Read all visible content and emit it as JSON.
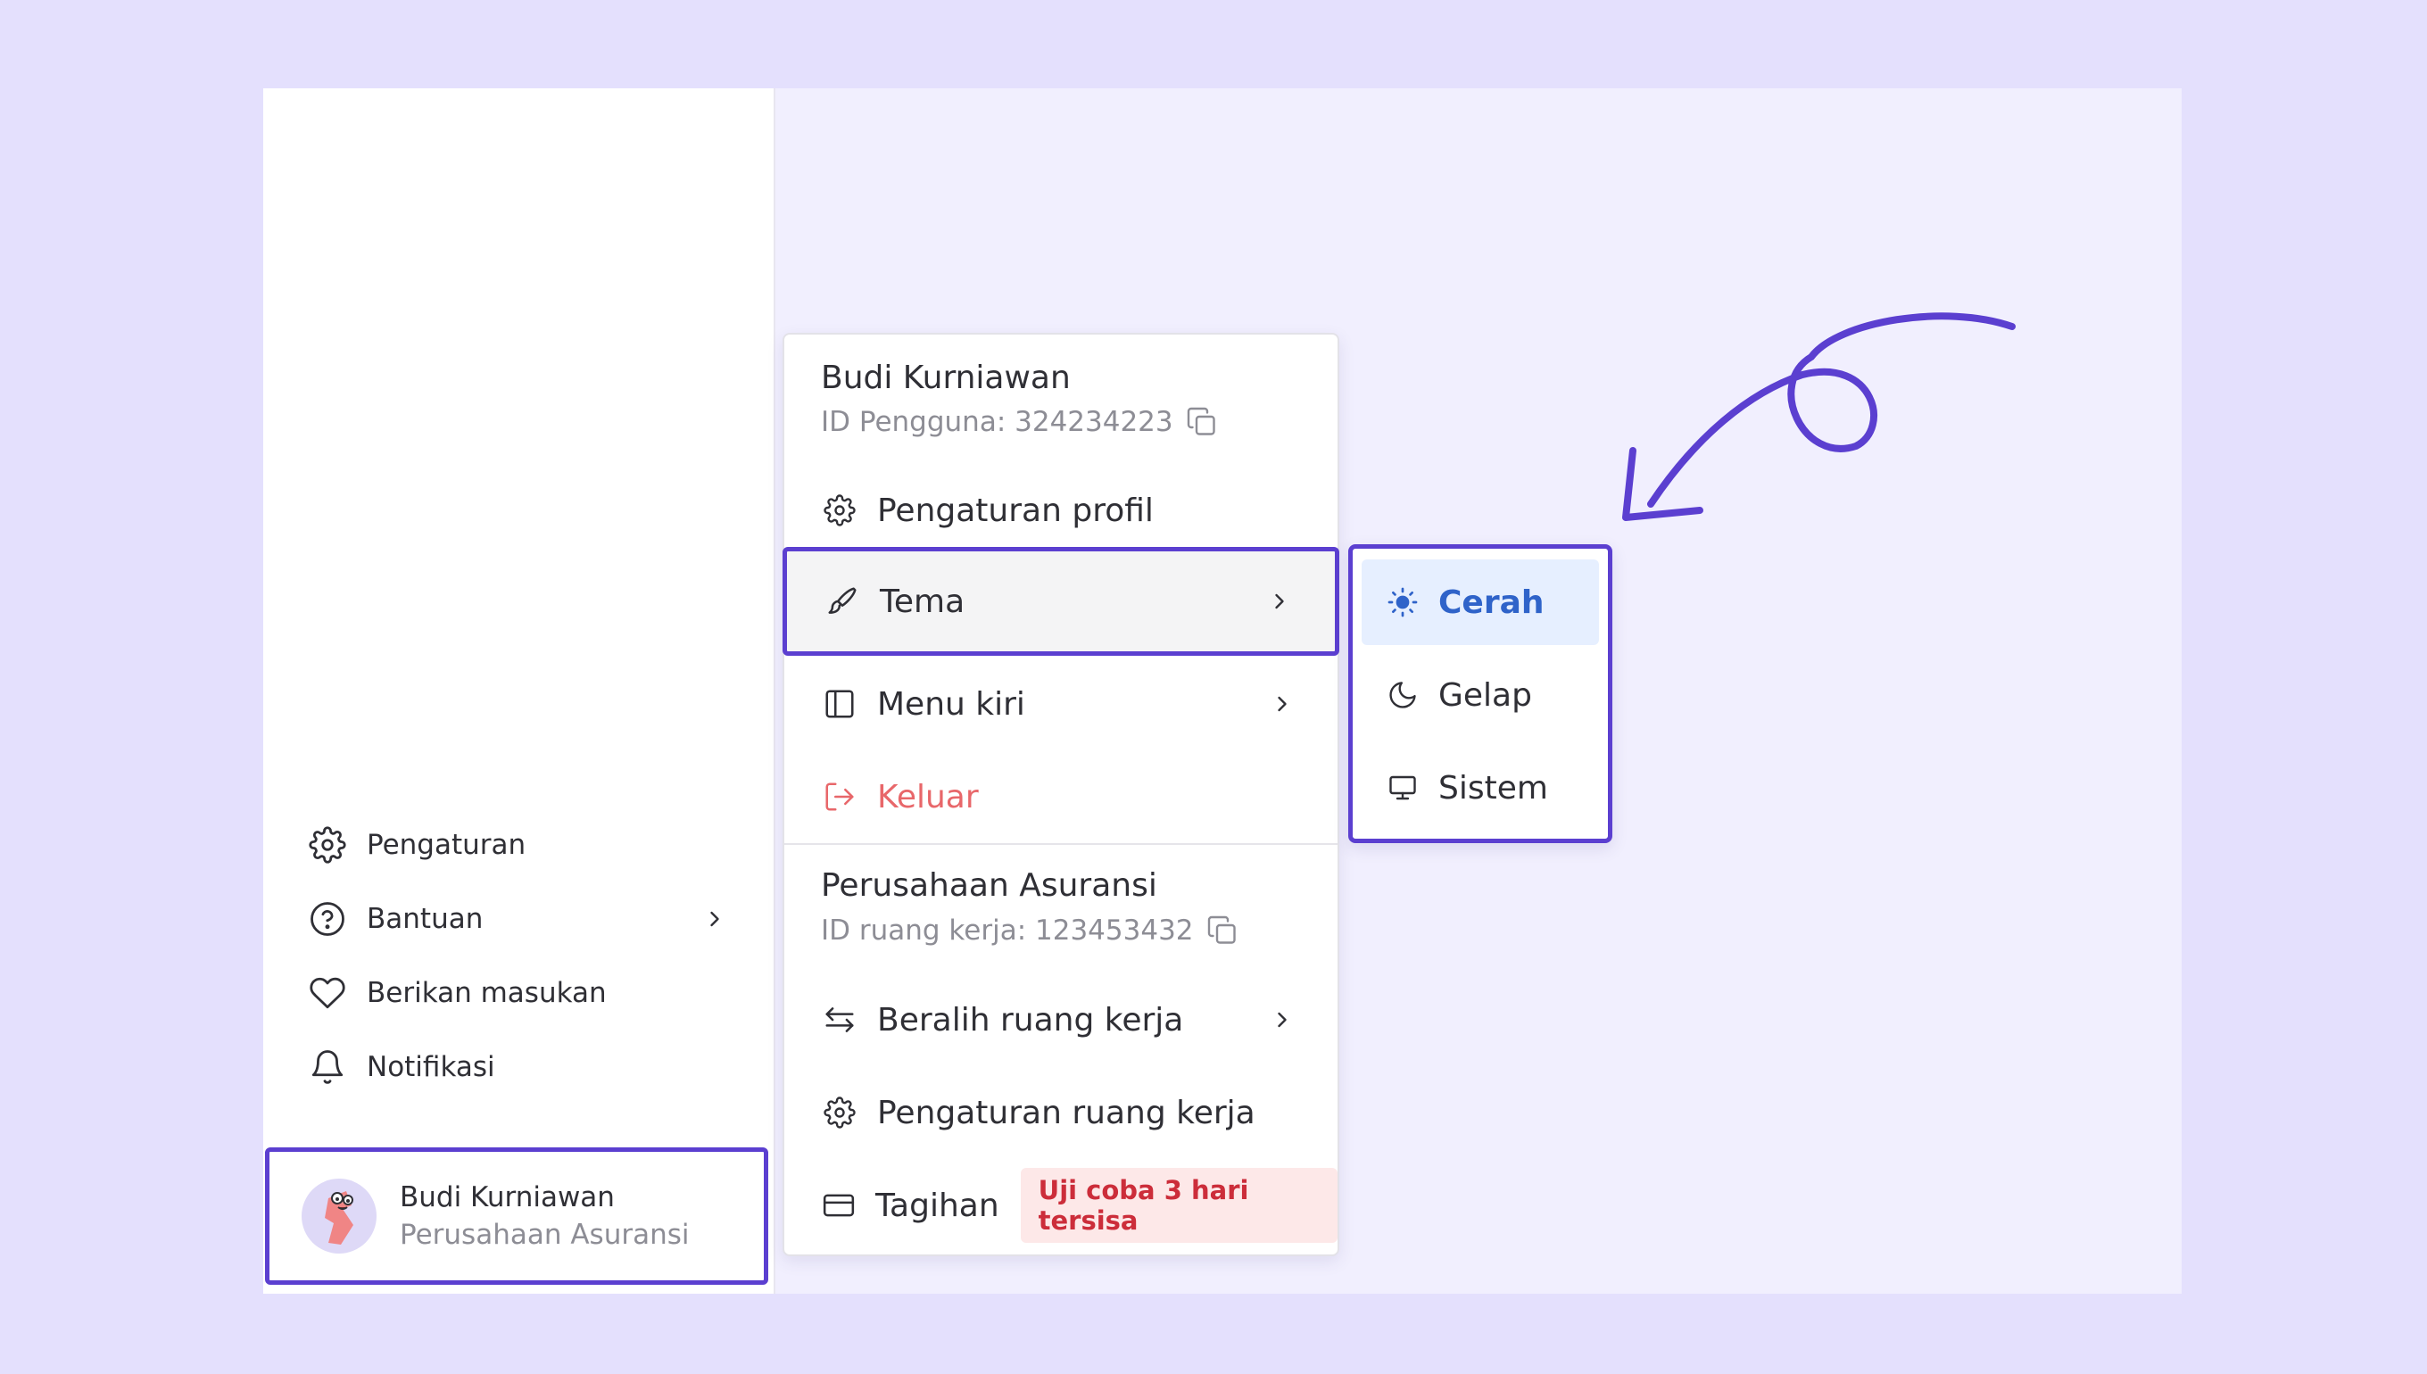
{
  "sidebar": {
    "items": [
      {
        "label": "Pengaturan",
        "icon": "gear-icon"
      },
      {
        "label": "Bantuan",
        "icon": "help-circle-icon"
      },
      {
        "label": "Berikan masukan",
        "icon": "heart-icon"
      },
      {
        "label": "Notifikasi",
        "icon": "bell-icon"
      }
    ],
    "user": {
      "name": "Budi Kurniawan",
      "org": "Perusahaan Asuransi"
    }
  },
  "menu": {
    "user_name": "Budi Kurniawan",
    "user_id": "ID Pengguna: 324234223",
    "items": {
      "profile": "Pengaturan profil",
      "theme": "Tema",
      "left_menu": "Menu kiri",
      "logout": "Keluar"
    },
    "workspace_name": "Perusahaan Asuransi",
    "workspace_id": "ID ruang kerja: 123453432",
    "workspace_items": {
      "switch": "Beralih ruang kerja",
      "settings": "Pengaturan ruang kerja",
      "billing": "Tagihan",
      "trial_badge": "Uji coba 3 hari tersisa"
    }
  },
  "theme_submenu": {
    "options": [
      {
        "label": "Cerah",
        "icon": "sun-icon",
        "selected": true
      },
      {
        "label": "Gelap",
        "icon": "moon-icon",
        "selected": false
      },
      {
        "label": "Sistem",
        "icon": "monitor-icon",
        "selected": false
      }
    ]
  },
  "colors": {
    "accent": "#5b3fd0",
    "selected_text": "#2f63c9",
    "danger": "#e8676a",
    "badge_text": "#cc2d3a",
    "badge_bg": "#fde8e8"
  }
}
